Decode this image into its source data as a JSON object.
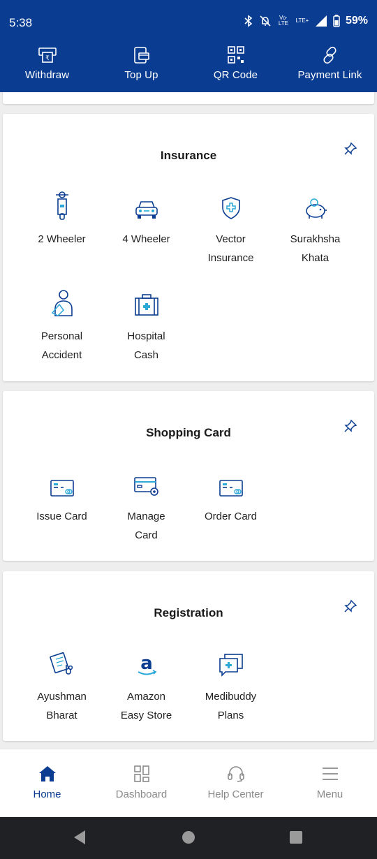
{
  "status": {
    "time": "5:38",
    "network": "LTE+",
    "volte": "Vo· LTE",
    "battery": "59%"
  },
  "actions": [
    {
      "label": "Withdraw",
      "icon": "withdraw-icon"
    },
    {
      "label": "Top Up",
      "icon": "top-up-icon"
    },
    {
      "label": "QR Code",
      "icon": "qr-code-icon"
    },
    {
      "label": "Payment Link",
      "icon": "link-icon"
    }
  ],
  "insurance": {
    "title": "Insurance",
    "items": [
      {
        "label": "2 Wheeler",
        "icon": "scooter-icon"
      },
      {
        "label": "4 Wheeler",
        "icon": "car-icon"
      },
      {
        "label": "Vector\nInsurance",
        "icon": "shield-plus-icon"
      },
      {
        "label": "Surakhsha\nKhata",
        "icon": "piggy-bank-icon"
      },
      {
        "label": "Personal\nAccident",
        "icon": "injured-person-icon"
      },
      {
        "label": "Hospital\nCash",
        "icon": "medical-kit-icon"
      }
    ]
  },
  "shopping": {
    "title": "Shopping Card",
    "items": [
      {
        "label": "Issue Card",
        "icon": "card-icon"
      },
      {
        "label": "Manage\nCard",
        "icon": "card-settings-icon"
      },
      {
        "label": "Order Card",
        "icon": "card-order-icon"
      }
    ]
  },
  "registration": {
    "title": "Registration",
    "items": [
      {
        "label": "Ayushman\nBharat",
        "icon": "health-form-icon"
      },
      {
        "label": "Amazon\nEasy Store",
        "icon": "amazon-icon"
      },
      {
        "label": "Medibuddy\nPlans",
        "icon": "medical-chat-icon"
      }
    ]
  },
  "nav": [
    {
      "label": "Home",
      "icon": "home-icon",
      "active": true
    },
    {
      "label": "Dashboard",
      "icon": "dashboard-icon",
      "active": false
    },
    {
      "label": "Help Center",
      "icon": "headset-icon",
      "active": false
    },
    {
      "label": "Menu",
      "icon": "menu-icon",
      "active": false
    }
  ],
  "colors": {
    "primary": "#0a3d91",
    "accent": "#29a8d9",
    "inactive": "#8a8a8a"
  }
}
